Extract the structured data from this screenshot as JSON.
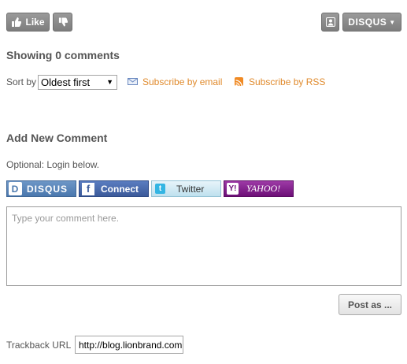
{
  "top_bar": {
    "like_label": "Like",
    "brand_label": "DISQUS"
  },
  "comments": {
    "count_title": "Showing 0 comments"
  },
  "sort": {
    "label": "Sort by",
    "selected": "Oldest first"
  },
  "subscribe": {
    "email_label": "Subscribe by email",
    "rss_label": "Subscribe by RSS"
  },
  "add_comment": {
    "title": "Add New Comment",
    "optional_text": "Optional: Login below.",
    "logins": {
      "disqus": "DISQUS",
      "facebook": "Connect",
      "twitter": "Twitter",
      "yahoo": "YAHOO!"
    },
    "comment_placeholder": "Type your comment here.",
    "post_label": "Post as ..."
  },
  "trackback": {
    "label": "Trackback URL",
    "value": "http://blog.lionbrand.com"
  },
  "colors": {
    "link": "#e08a2c",
    "grey_button": "#8a8a8a",
    "facebook": "#3b5a9a",
    "yahoo": "#6d0f77"
  }
}
